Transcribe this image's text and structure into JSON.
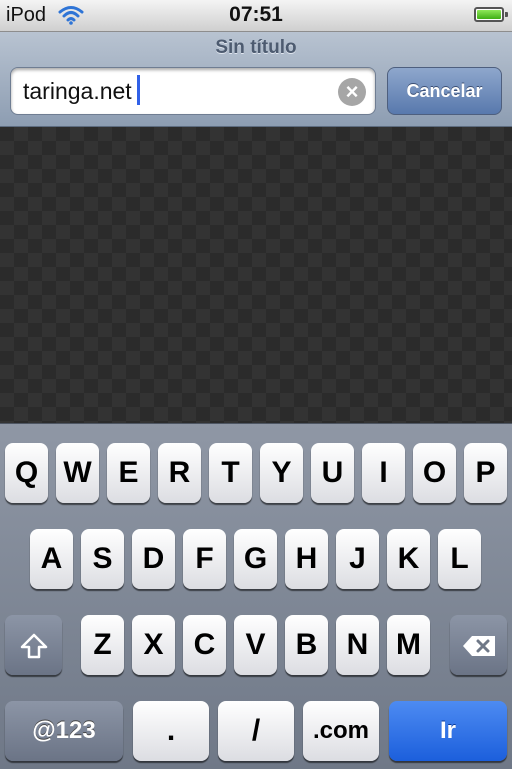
{
  "status_bar": {
    "carrier": "iPod",
    "time": "07:51"
  },
  "nav": {
    "page_title": "Sin título",
    "url_value": "taringa.net",
    "cancel_label": "Cancelar"
  },
  "keyboard": {
    "row1": [
      "Q",
      "W",
      "E",
      "R",
      "T",
      "Y",
      "U",
      "I",
      "O",
      "P"
    ],
    "row2": [
      "A",
      "S",
      "D",
      "F",
      "G",
      "H",
      "J",
      "K",
      "L"
    ],
    "row3": [
      "Z",
      "X",
      "C",
      "V",
      "B",
      "N",
      "M"
    ],
    "bottom": {
      "numbers_label": "@123",
      "period_label": ".",
      "slash_label": "/",
      "dotcom_label": ".com",
      "go_label": "Ir"
    }
  },
  "colors": {
    "go_key": "#1c5fdc",
    "cancel_button": "#5879ad",
    "caret": "#3161e8"
  },
  "icons": {
    "wifi": "wifi-icon",
    "battery": "battery-icon",
    "clear": "clear-text-icon",
    "shift": "shift-icon",
    "backspace": "backspace-icon"
  }
}
